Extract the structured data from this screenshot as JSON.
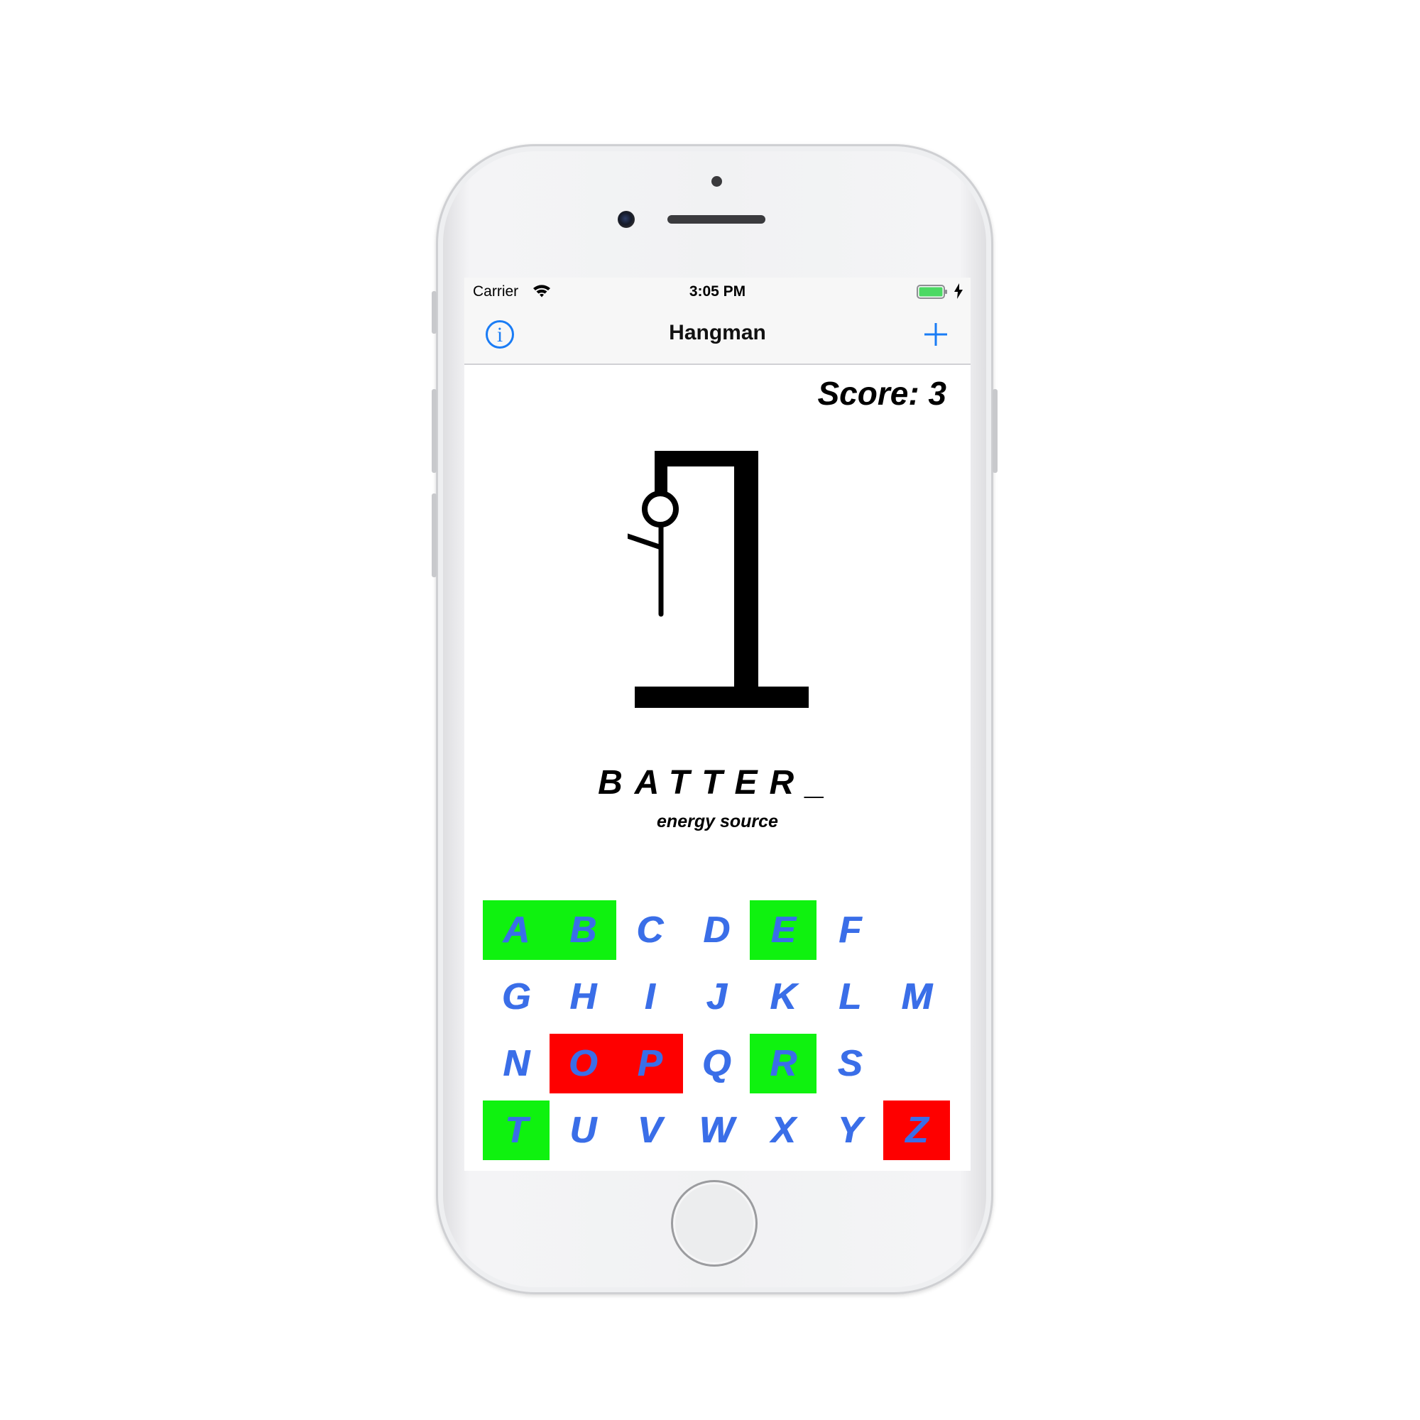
{
  "status_bar": {
    "carrier": "Carrier",
    "time": "3:05 PM"
  },
  "nav": {
    "title": "Hangman",
    "left_icon": "info-icon",
    "right_icon": "plus-icon"
  },
  "game": {
    "score_text": "Score: 3",
    "word_display": "BATTER_",
    "hint": "energy source"
  },
  "keyboard": {
    "colors": {
      "correct": "#0ff20f",
      "wrong": "#fe0000",
      "letter": "#3a6ee8"
    },
    "keys": [
      {
        "letter": "A",
        "state": "correct"
      },
      {
        "letter": "B",
        "state": "correct"
      },
      {
        "letter": "C",
        "state": "unused"
      },
      {
        "letter": "D",
        "state": "unused"
      },
      {
        "letter": "E",
        "state": "correct"
      },
      {
        "letter": "F",
        "state": "unused"
      },
      {
        "letter": "G",
        "state": "unused"
      },
      {
        "letter": "H",
        "state": "unused"
      },
      {
        "letter": "I",
        "state": "unused"
      },
      {
        "letter": "J",
        "state": "unused"
      },
      {
        "letter": "K",
        "state": "unused"
      },
      {
        "letter": "L",
        "state": "unused"
      },
      {
        "letter": "M",
        "state": "unused"
      },
      {
        "letter": "N",
        "state": "unused"
      },
      {
        "letter": "O",
        "state": "wrong"
      },
      {
        "letter": "P",
        "state": "wrong"
      },
      {
        "letter": "Q",
        "state": "unused"
      },
      {
        "letter": "R",
        "state": "correct"
      },
      {
        "letter": "S",
        "state": "unused"
      },
      {
        "letter": "T",
        "state": "correct"
      },
      {
        "letter": "U",
        "state": "unused"
      },
      {
        "letter": "V",
        "state": "unused"
      },
      {
        "letter": "W",
        "state": "unused"
      },
      {
        "letter": "X",
        "state": "unused"
      },
      {
        "letter": "Y",
        "state": "unused"
      },
      {
        "letter": "Z",
        "state": "wrong"
      }
    ]
  }
}
